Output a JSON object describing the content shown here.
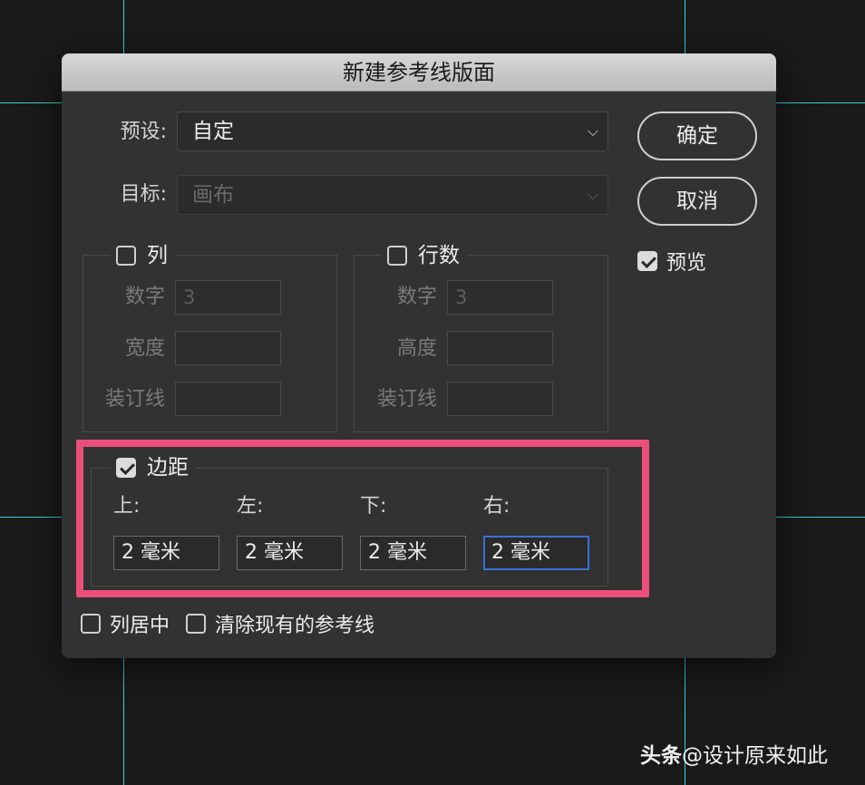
{
  "dialog": {
    "title": "新建参考线版面",
    "preset_label": "预设:",
    "preset_value": "自定",
    "target_label": "目标:",
    "target_value": "画布",
    "ok_label": "确定",
    "cancel_label": "取消",
    "preview_label": "预览",
    "preview_checked": true
  },
  "columns": {
    "label": "列",
    "checked": false,
    "number_label": "数字",
    "number_value": "3",
    "width_label": "宽度",
    "width_value": "",
    "gutter_label": "装订线",
    "gutter_value": ""
  },
  "rows": {
    "label": "行数",
    "checked": false,
    "number_label": "数字",
    "number_value": "3",
    "height_label": "高度",
    "height_value": "",
    "gutter_label": "装订线",
    "gutter_value": ""
  },
  "margin": {
    "label": "边距",
    "checked": true,
    "top_label": "上:",
    "left_label": "左:",
    "bottom_label": "下:",
    "right_label": "右:",
    "top_value": "2 毫米",
    "left_value": "2 毫米",
    "bottom_value": "2 毫米",
    "right_value": "2 毫米"
  },
  "options": {
    "center_columns_label": "列居中",
    "center_columns_checked": false,
    "clear_existing_label": "清除现有的参考线",
    "clear_existing_checked": false
  },
  "watermark": {
    "brand": "头条",
    "handle": "@设计原来如此"
  },
  "colors": {
    "guide": "#3fd0d8",
    "highlight": "#ea4f7c",
    "focus": "#3b6fd6"
  }
}
